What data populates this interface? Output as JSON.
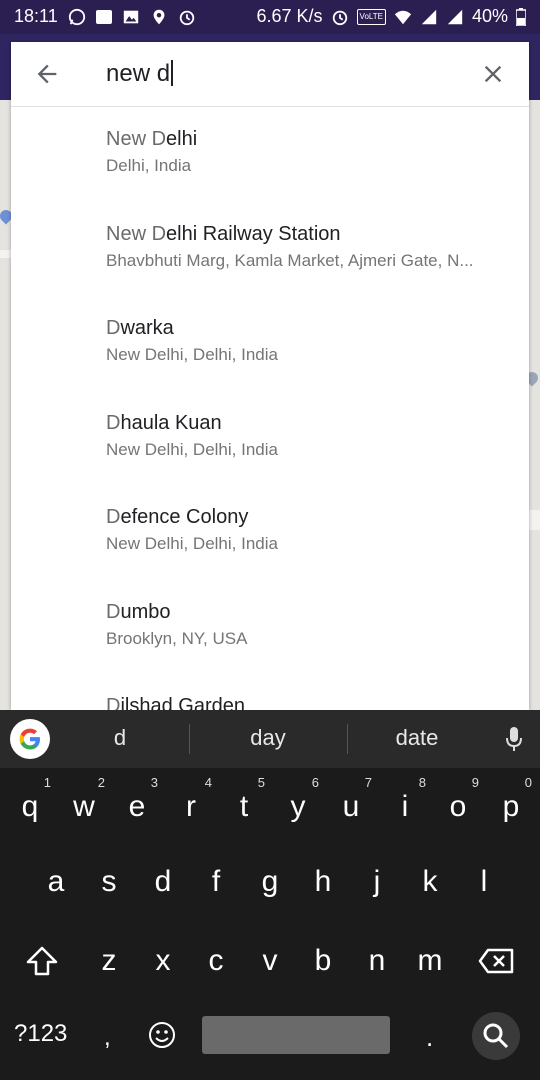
{
  "status_bar": {
    "time": "18:11",
    "speed": "6.67 K/s",
    "network_badge": "VoLTE",
    "battery": "40%"
  },
  "search": {
    "query": "new d",
    "back_icon": "arrow-back-icon",
    "clear_icon": "close-icon"
  },
  "results": [
    {
      "title_prefix": "New D",
      "title_rest": "elhi",
      "subtitle": "Delhi, India"
    },
    {
      "title_prefix": "New D",
      "title_rest": "elhi Railway Station",
      "subtitle": "Bhavbhuti Marg, Kamla Market, Ajmeri Gate, N..."
    },
    {
      "title_prefix": "D",
      "title_rest": "warka",
      "subtitle": "New Delhi, Delhi, India"
    },
    {
      "title_prefix": "D",
      "title_rest": "haula Kuan",
      "subtitle": "New Delhi, Delhi, India"
    },
    {
      "title_prefix": "D",
      "title_rest": "efence Colony",
      "subtitle": "New Delhi, Delhi, India"
    },
    {
      "title_prefix": "D",
      "title_rest": "umbo",
      "subtitle": "Brooklyn, NY, USA"
    },
    {
      "title_prefix": "D",
      "title_rest": "ilshad Garden",
      "subtitle": ""
    }
  ],
  "keyboard": {
    "suggestions": [
      "d",
      "day",
      "date"
    ],
    "row1": [
      {
        "k": "q",
        "n": "1"
      },
      {
        "k": "w",
        "n": "2"
      },
      {
        "k": "e",
        "n": "3"
      },
      {
        "k": "r",
        "n": "4"
      },
      {
        "k": "t",
        "n": "5"
      },
      {
        "k": "y",
        "n": "6"
      },
      {
        "k": "u",
        "n": "7"
      },
      {
        "k": "i",
        "n": "8"
      },
      {
        "k": "o",
        "n": "9"
      },
      {
        "k": "p",
        "n": "0"
      }
    ],
    "row2": [
      "a",
      "s",
      "d",
      "f",
      "g",
      "h",
      "j",
      "k",
      "l"
    ],
    "row3": [
      "z",
      "x",
      "c",
      "v",
      "b",
      "n",
      "m"
    ],
    "symbols_key": "?123",
    "comma": ",",
    "period": ".",
    "colors": {
      "bg": "#1b1b1b",
      "suggestion_bar": "#2a2a2a",
      "space": "#6a6a6a"
    }
  },
  "colors": {
    "status_bar": "#2b1f52",
    "card": "#ffffff",
    "accent_purple": "#2f2560"
  }
}
